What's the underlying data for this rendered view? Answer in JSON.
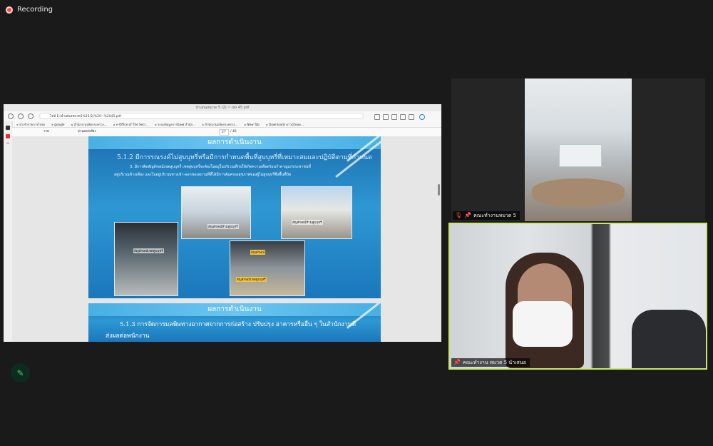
{
  "recording": {
    "label": "Recording"
  },
  "browser": {
    "tab_title": "นำเสนอหมวด 5 (2) ~ iso 45.pdf",
    "url": "E:/นำเสนอหมวด5%20(2)%20~%2045.pdf",
    "url_prefix": "ไฟล์",
    "bookmarks": [
      "นำเข้ารายการโปรด",
      "google",
      "สำนักงานปลัดกระทรวง...",
      "e-Office of The Secr...",
      "ระบบข้อมูลการนิเทศ สำนัก...",
      "สำนักงานปลัดกระทรวง...",
      "New Tab",
      "Downloads ดาวน์โหลด..."
    ]
  },
  "pdf_toolbar": {
    "view_label": "วาด",
    "readaloud_label": "อ่านออกเสียง",
    "page_current": "27",
    "page_total": "/ 40"
  },
  "slide1": {
    "header": "ผลการดำเนินงาน",
    "heading": "5.1.2 มีการรณรงค์ไม่สูบบุหรี่หรือมีการกำหนดพื้นที่สูบบุหรี่ที่เหมาะสมและปฏิบัติตามที่กำหนด",
    "body_line1": "3. มีการติดสัญลักษณ์เขตสูบบุหรี่ เขตสูบบุหรี่จะต้องไม่อยู่ในบริเวณที่ก่อให้เกิดความเดือดร้อนรำคาญแก่ประชาชนที่",
    "body_line2": "อยู่บริเวณข้างเคียง และไม่อยู่บริเวณทางเข้า-ออกของสถานที่ที่ได้มีการคุ้มครองสุขภาพของผู้ไม่สูบบุหรี่ซึ่งพื้นที่ปิด",
    "photo_labels": [
      "สัญลักษณ์ห้ามสูบบุหรี่",
      "สัญลักษณ์ห้ามสูบบุหรี่",
      "สัญลักษณ์เขตสูบบุหรี่",
      "สัญลักษณ์",
      "สัญลักษณ์เขตสูบบุหรี่"
    ]
  },
  "slide2": {
    "header": "ผลการดำเนินงาน",
    "heading": "5.1.3 การจัดการมลพิษทางอากาศจากการก่อสร้าง ปรับปรุง อาคารหรืออื่น ๆ ในสำนักงานที่",
    "heading_line2": "ส่งผลต่อพนักงาน"
  },
  "participants": [
    {
      "name": "คณะทำงานหมวด 5",
      "muted": true
    },
    {
      "name": "คณะทำงาน หมวด 5 นำเสนอ",
      "muted": false
    }
  ],
  "colors": {
    "active_speaker": "#c9e86b",
    "slide_blue": "#2e98d4",
    "recording_red": "#e55b4a",
    "annotate_green": "#3ecf75"
  },
  "icons": [
    "record-dot-icon",
    "pin-icon",
    "mic-off-icon",
    "pen-icon"
  ]
}
